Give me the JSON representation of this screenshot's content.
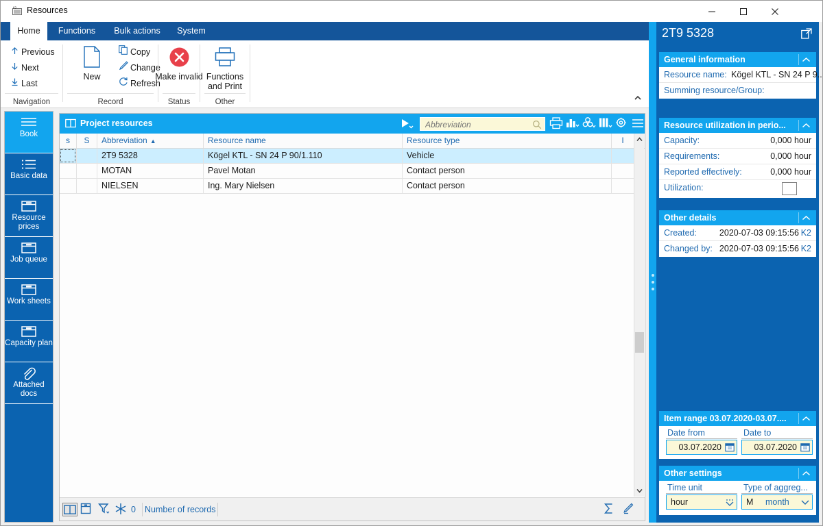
{
  "window": {
    "title": "Resources",
    "icon": "app-icon",
    "minimize": "minimize-icon",
    "maximize": "maximize-icon",
    "close": "close-icon"
  },
  "ribbon": {
    "tabs": [
      {
        "label": "Home",
        "active": true
      },
      {
        "label": "Functions",
        "active": false
      },
      {
        "label": "Bulk actions",
        "active": false
      },
      {
        "label": "System",
        "active": false
      }
    ],
    "groups": [
      {
        "label": "Navigation",
        "commands": [
          {
            "label": "Previous",
            "icon": "arrow-up-icon"
          },
          {
            "label": "Next",
            "icon": "arrow-down-icon"
          },
          {
            "label": "Last",
            "icon": "arrow-down-to-line-icon"
          }
        ]
      },
      {
        "label": "Record",
        "big": [
          {
            "label": "New",
            "icon": "new-document-icon"
          }
        ],
        "commands": [
          {
            "label": "Copy",
            "icon": "copy-icon"
          },
          {
            "label": "Change",
            "icon": "pencil-icon"
          },
          {
            "label": "Refresh",
            "icon": "refresh-icon"
          }
        ]
      },
      {
        "label": "Status",
        "big": [
          {
            "label": "Make invalid",
            "icon": "red-x-circle-icon"
          }
        ]
      },
      {
        "label": "Other",
        "big": [
          {
            "label": "Functions and Print",
            "icon": "printer-icon"
          }
        ]
      }
    ],
    "collapse_icon": "chevron-up-icon"
  },
  "sidebar": {
    "items": [
      {
        "label": "Book",
        "icon": "book-lines-icon",
        "active": true
      },
      {
        "label": "Basic data",
        "icon": "list-icon",
        "active": false
      },
      {
        "label": "Resource prices",
        "icon": "box-icon",
        "active": false
      },
      {
        "label": "Job queue",
        "icon": "box-icon",
        "active": false
      },
      {
        "label": "Work sheets",
        "icon": "box-icon",
        "active": false
      },
      {
        "label": "Capacity plan",
        "icon": "box-icon",
        "active": false
      },
      {
        "label": "Attached docs",
        "icon": "paperclip-icon",
        "active": false
      }
    ]
  },
  "grid": {
    "title": "Project resources",
    "title_icon": "book-open-icon",
    "play_icon": "play-filter-icon",
    "search": {
      "value": "",
      "placeholder": "Abbreviation",
      "icon": "search-icon"
    },
    "toolbar_icons": [
      "print-icon",
      "chart-bar-icon",
      "pivot-icon",
      "columns-icon",
      "gear-icon",
      "menu-icon"
    ],
    "columns": [
      {
        "label": "s"
      },
      {
        "label": "S"
      },
      {
        "label": "Abbreviation",
        "sort": "▲"
      },
      {
        "label": "Resource name"
      },
      {
        "label": "Resource type"
      },
      {
        "label": "I"
      }
    ],
    "rows": [
      {
        "s": "",
        "S": "",
        "abbreviation": "2T9 5328",
        "name": "Kögel KTL - SN 24 P 90/1.110",
        "type": "Vehicle",
        "i": "",
        "selected": true
      },
      {
        "s": "",
        "S": "",
        "abbreviation": "MOTAN",
        "name": "Pavel Motan",
        "type": "Contact person",
        "i": "",
        "selected": false
      },
      {
        "s": "",
        "S": "",
        "abbreviation": "NIELSEN",
        "name": "Ing. Mary Nielsen",
        "type": "Contact person",
        "i": "",
        "selected": false
      }
    ],
    "footer": {
      "icons": [
        "book-toggle-icon",
        "archive-icon",
        "filter-icon",
        "snowflake-icon"
      ],
      "count": "0",
      "records_label": "Number of records",
      "sum_icon": "sigma-icon",
      "edit_icon": "pen-icon"
    },
    "scroll": {
      "up": "chevron-up-icon",
      "down": "chevron-down-icon"
    }
  },
  "details": {
    "header": {
      "title": "2T9 5328",
      "expand_icon": "open-external-icon"
    },
    "sections": [
      {
        "title": "General information",
        "chevron": "chevron-up-icon",
        "rows": [
          {
            "label": "Resource name:",
            "value": "Kögel KTL - SN 24 P 9..."
          },
          {
            "label": "Summing resource/Group:",
            "value": ""
          }
        ]
      },
      {
        "title": "Resource utilization in perio...",
        "chevron": "chevron-up-icon",
        "rows": [
          {
            "label": "Capacity:",
            "value": "0,000 hour"
          },
          {
            "label": "Requirements:",
            "value": "0,000 hour"
          },
          {
            "label": "Reported effectively:",
            "value": "0,000 hour"
          },
          {
            "label": "Utilization:",
            "value": ""
          }
        ]
      },
      {
        "title": "Other details",
        "chevron": "chevron-up-icon",
        "rows": [
          {
            "label": "Created:",
            "value": "2020-07-03 09:15:56",
            "user": "K2"
          },
          {
            "label": "Changed by:",
            "value": "2020-07-03 09:15:56",
            "user": "K2"
          }
        ]
      }
    ],
    "item_range": {
      "title": "Item range 03.07.2020-03.07....",
      "chevron": "chevron-up-icon",
      "date_from": {
        "label": "Date from",
        "value": "03.07.2020",
        "icon": "calendar-icon"
      },
      "date_to": {
        "label": "Date to",
        "value": "03.07.2020",
        "icon": "calendar-icon"
      }
    },
    "other_settings": {
      "title": "Other settings",
      "chevron": "chevron-up-icon",
      "time_unit": {
        "label": "Time unit",
        "value": "hour",
        "icon": "dropdown-icon"
      },
      "aggregation": {
        "label": "Type of aggreg...",
        "code": "M",
        "value": "month",
        "icon": "chevron-down-icon"
      }
    }
  },
  "colors": {
    "ribbon_blue": "#14559a",
    "accent_cyan": "#12a5ee",
    "panel_blue": "#0b63b0",
    "link_blue": "#1f6ab0",
    "field_yellow": "#fbf8d8",
    "row_selected": "#cceeff",
    "red": "#e8404a"
  }
}
